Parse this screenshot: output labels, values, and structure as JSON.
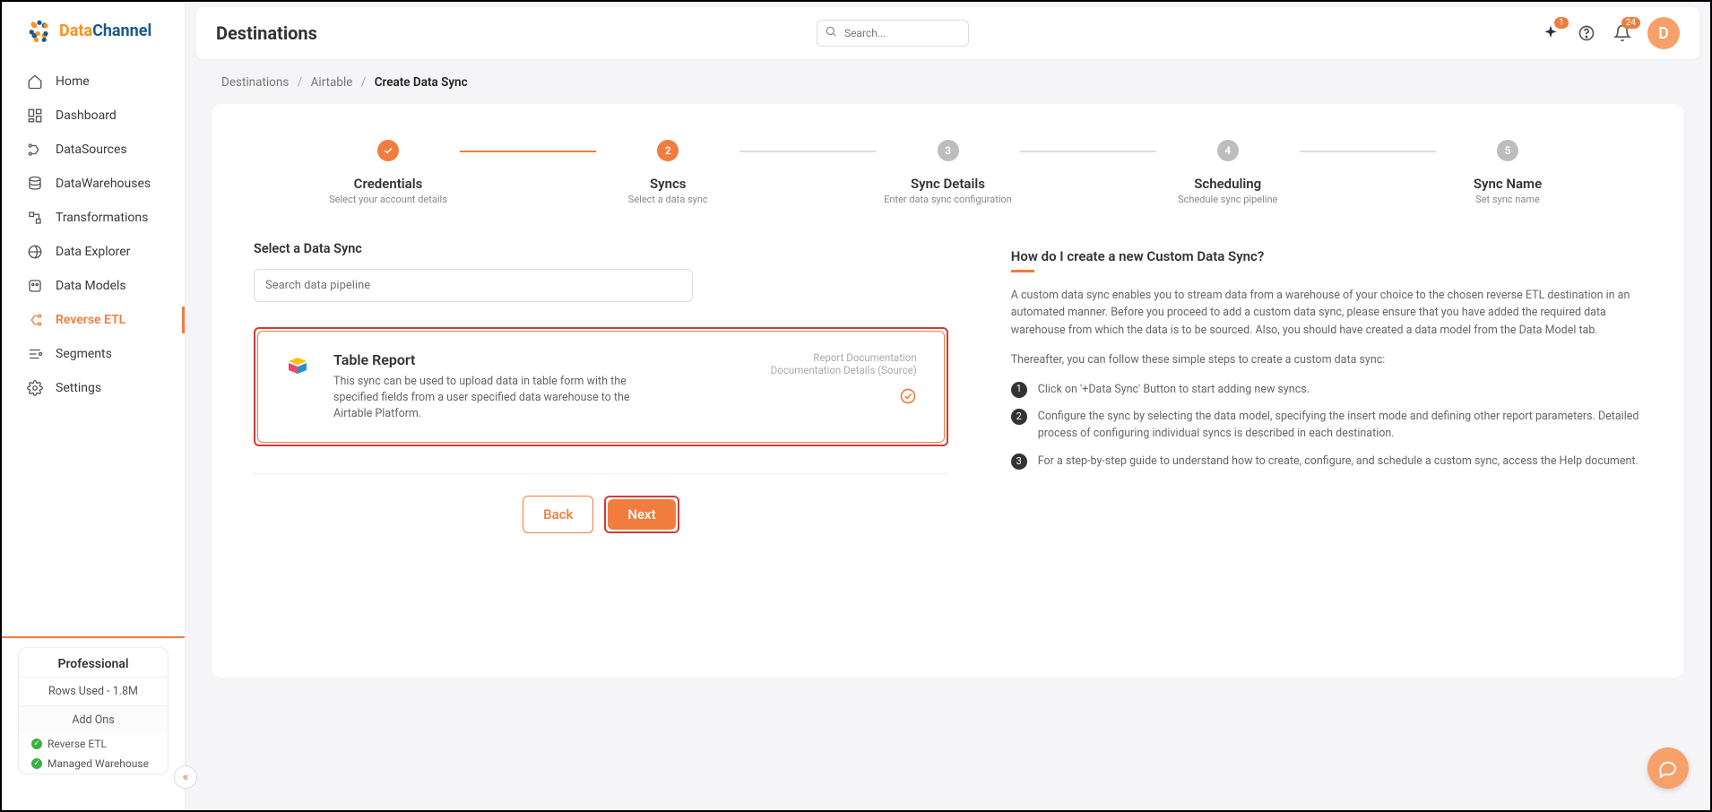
{
  "brand": {
    "name_part1": "Data",
    "name_part2": "Channel"
  },
  "sidebar": {
    "items": [
      {
        "label": "Home"
      },
      {
        "label": "Dashboard"
      },
      {
        "label": "DataSources"
      },
      {
        "label": "DataWarehouses"
      },
      {
        "label": "Transformations"
      },
      {
        "label": "Data Explorer"
      },
      {
        "label": "Data Models"
      },
      {
        "label": "Reverse ETL"
      },
      {
        "label": "Segments"
      },
      {
        "label": "Settings"
      }
    ],
    "plan": {
      "title": "Professional",
      "rows_used": "Rows Used - 1.8M",
      "addons_title": "Add Ons",
      "addons": [
        {
          "label": "Reverse ETL"
        },
        {
          "label": "Managed Warehouse"
        }
      ]
    }
  },
  "topbar": {
    "title": "Destinations",
    "search_placeholder": "Search...",
    "sparkle_badge": "1",
    "bell_badge": "24",
    "avatar_initial": "D"
  },
  "breadcrumb": {
    "items": [
      "Destinations",
      "Airtable"
    ],
    "current": "Create Data Sync"
  },
  "stepper": {
    "steps": [
      {
        "num": "✓",
        "title": "Credentials",
        "sub": "Select your account details",
        "state": "done"
      },
      {
        "num": "2",
        "title": "Syncs",
        "sub": "Select a data sync",
        "state": "current"
      },
      {
        "num": "3",
        "title": "Sync Details",
        "sub": "Enter data sync configuration",
        "state": "pending"
      },
      {
        "num": "4",
        "title": "Scheduling",
        "sub": "Schedule sync pipeline",
        "state": "pending"
      },
      {
        "num": "5",
        "title": "Sync Name",
        "sub": "Set sync name",
        "state": "pending"
      }
    ]
  },
  "syncs": {
    "section_title": "Select a Data Sync",
    "search_placeholder": "Search data pipeline",
    "card": {
      "title": "Table Report",
      "desc": "This sync can be used to upload data in table form with the specified fields from a user specified data warehouse to the Airtable Platform.",
      "doc1": "Report Documentation",
      "doc2": "Documentation Details (Source)"
    }
  },
  "buttons": {
    "back": "Back",
    "next": "Next"
  },
  "help": {
    "title": "How do I create a new Custom Data Sync?",
    "body": "A custom data sync enables you to stream data from a warehouse of your choice to the chosen reverse ETL destination in an automated manner. Before you proceed to add a custom data sync, please ensure that you have added the required data warehouse from which the data is to be sourced. Also, you should have created a data model from the Data Model tab.",
    "body2": "Thereafter, you can follow these simple steps to create a custom data sync:",
    "steps": [
      "Click on '+Data Sync' Button to start adding new syncs.",
      "Configure the sync by selecting the data model, specifying the insert mode and defining other report parameters. Detailed process of configuring individual syncs is described in each destination.",
      "For a step-by-step guide to understand how to create, configure, and schedule a custom sync, access the Help document."
    ]
  }
}
